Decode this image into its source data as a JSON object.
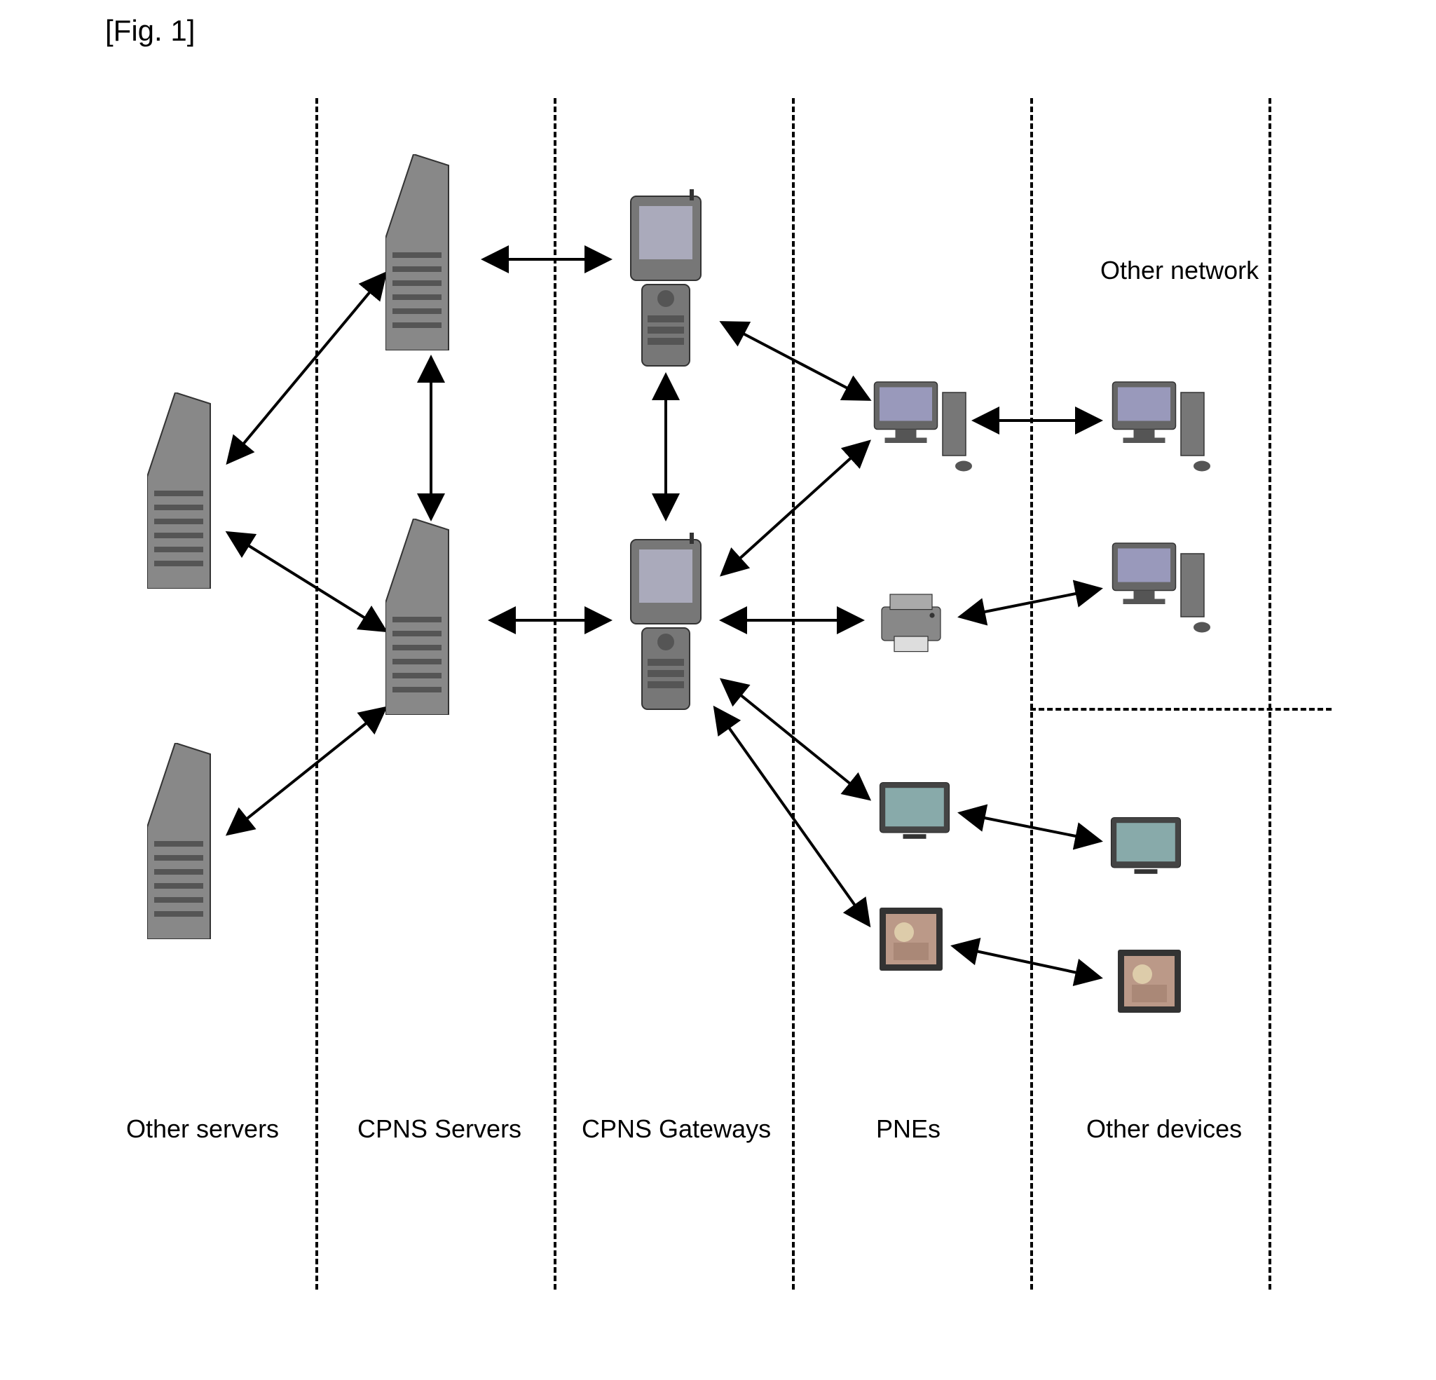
{
  "figure_label": "[Fig. 1]",
  "columns": {
    "other_servers": "Other servers",
    "cpns_servers": "CPNS Servers",
    "cpns_gateways": "CPNS Gateways",
    "pnes": "PNEs",
    "other_devices": "Other devices"
  },
  "section_label": "Other network"
}
